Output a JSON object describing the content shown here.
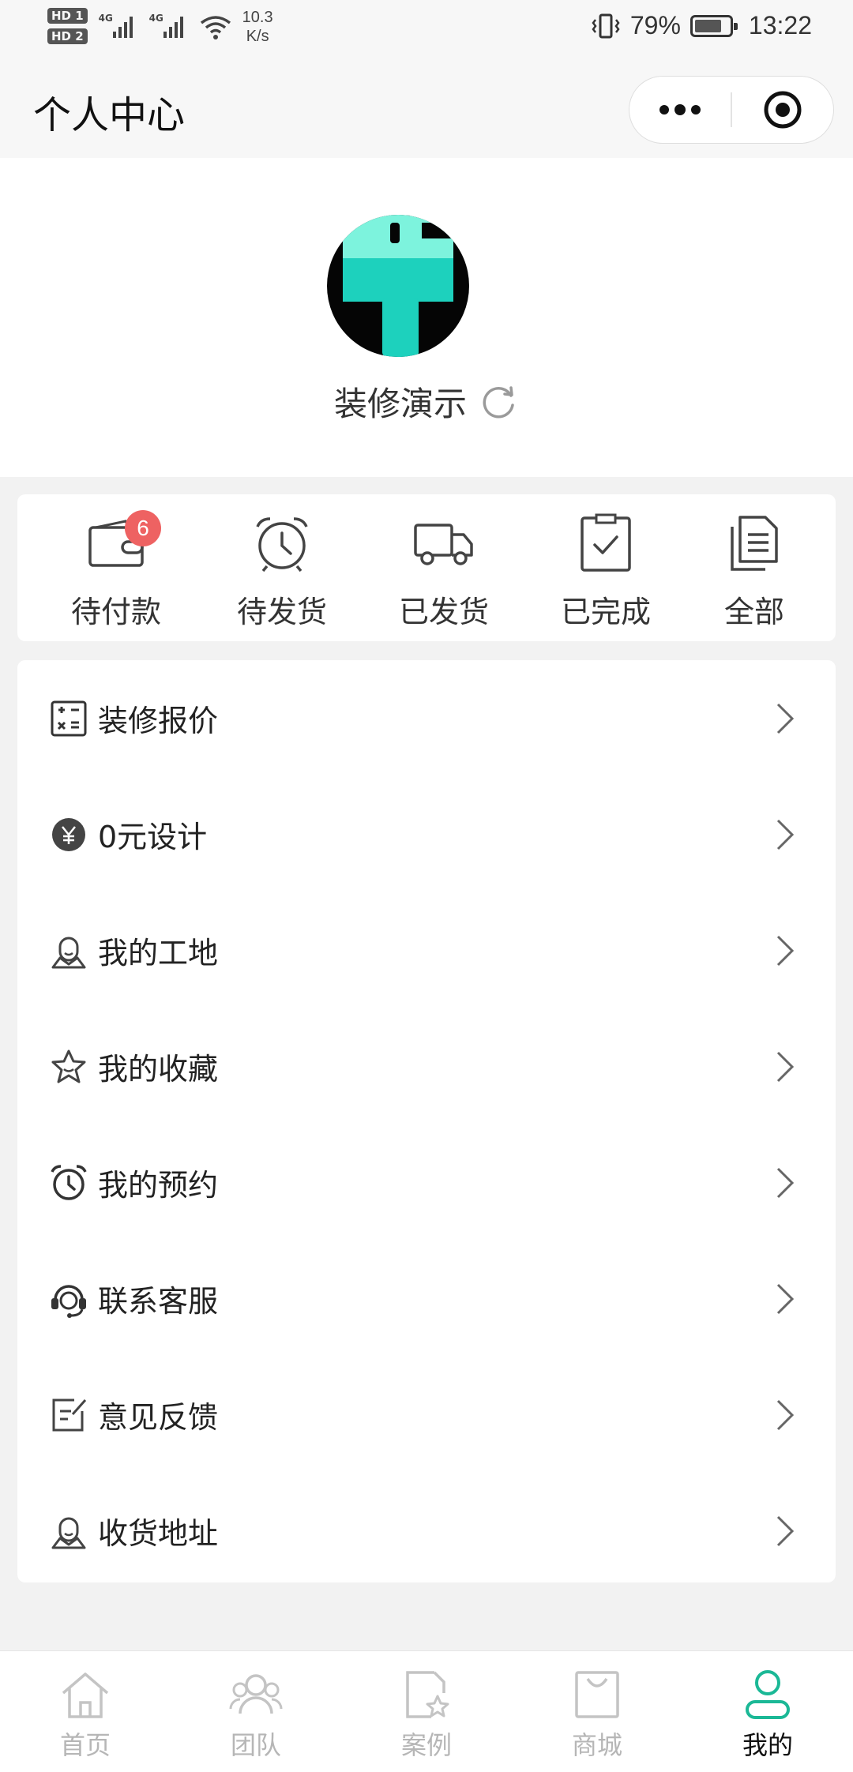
{
  "status_bar": {
    "hd1": "HD 1",
    "hd2": "HD 2",
    "signal1_label": "4G",
    "signal2_label": "4G",
    "net_speed_value": "10.3",
    "net_speed_unit": "K/s",
    "battery_percent": "79%",
    "battery_level": 0.79,
    "time": "13:22"
  },
  "nav": {
    "title": "个人中心"
  },
  "profile": {
    "username": "装修演示",
    "avatar_colors": {
      "background": "#050505",
      "accent": "#1dd1bd",
      "accent_light": "#7df3dd"
    }
  },
  "orders": {
    "items": [
      {
        "label": "待付款",
        "icon": "wallet-icon",
        "badge": "6"
      },
      {
        "label": "待发货",
        "icon": "alarm-clock-icon"
      },
      {
        "label": "已发货",
        "icon": "truck-icon"
      },
      {
        "label": "已完成",
        "icon": "clipboard-check-icon"
      },
      {
        "label": "全部",
        "icon": "documents-icon"
      }
    ],
    "badge_color": "#ee6262"
  },
  "menu": {
    "items": [
      {
        "label": "装修报价",
        "icon": "calculator-icon"
      },
      {
        "label": "0元设计",
        "icon": "yen-coin-icon"
      },
      {
        "label": "我的工地",
        "icon": "worker-icon"
      },
      {
        "label": "我的收藏",
        "icon": "star-icon"
      },
      {
        "label": "我的预约",
        "icon": "alarm-clock-icon"
      },
      {
        "label": "联系客服",
        "icon": "headset-icon"
      },
      {
        "label": "意见反馈",
        "icon": "feedback-edit-icon"
      },
      {
        "label": "收货地址",
        "icon": "location-person-icon"
      }
    ]
  },
  "tabs": {
    "items": [
      {
        "label": "首页",
        "icon": "home-icon"
      },
      {
        "label": "团队",
        "icon": "team-icon"
      },
      {
        "label": "案例",
        "icon": "case-document-star-icon"
      },
      {
        "label": "商城",
        "icon": "shopping-bag-icon"
      },
      {
        "label": "我的",
        "icon": "user-icon",
        "active": true
      }
    ],
    "active_color": "#1bb896",
    "inactive_color": "#b6b6b6"
  }
}
